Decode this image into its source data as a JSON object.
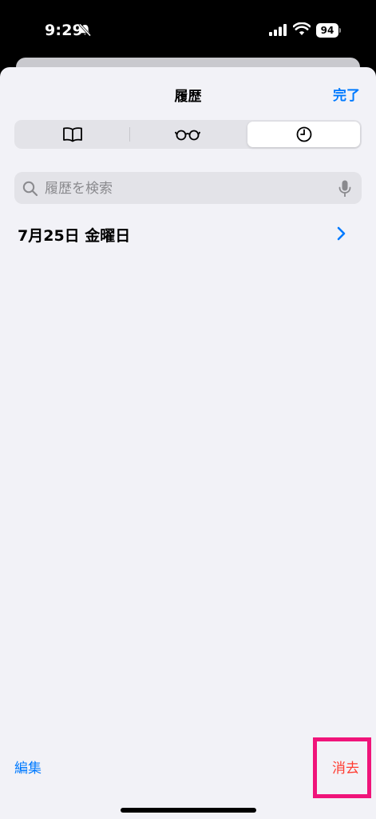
{
  "status_bar": {
    "time": "9:29",
    "battery_level": "94",
    "icons": [
      "bell-slash-icon",
      "signal-icon",
      "wifi-icon",
      "battery-icon"
    ]
  },
  "sheet": {
    "title": "履歴",
    "done_label": "完了"
  },
  "segments": [
    {
      "icon": "book-icon",
      "selected": false
    },
    {
      "icon": "glasses-icon",
      "selected": false
    },
    {
      "icon": "clock-icon",
      "selected": true
    }
  ],
  "search": {
    "placeholder": "履歴を検索",
    "value": ""
  },
  "history": {
    "sections": [
      {
        "label": "7月25日 金曜日"
      }
    ]
  },
  "toolbar": {
    "edit_label": "編集",
    "clear_label": "消去"
  },
  "colors": {
    "accent": "#007aff",
    "destructive": "#ff3b30",
    "highlight": "#f0147a",
    "sheet_background": "#f2f2f7"
  }
}
